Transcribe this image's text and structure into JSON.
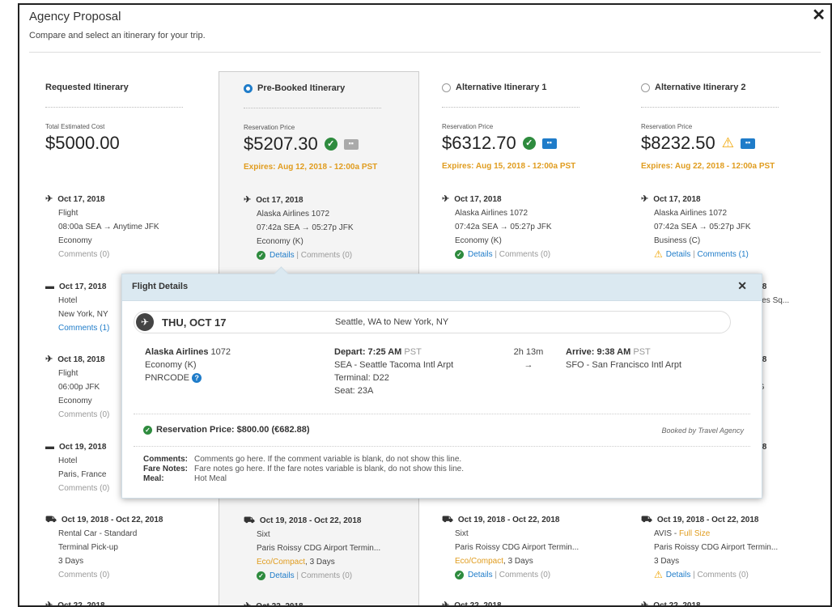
{
  "modal": {
    "title": "Agency Proposal",
    "subtitle": "Compare and select an itinerary for your trip.",
    "close_icon": "close-icon"
  },
  "columns": [
    {
      "header": "Requested Itinerary",
      "has_radio": false,
      "selected": false,
      "price_label": "Total Estimated Cost",
      "price": "$5000.00",
      "flight1": {
        "date": "Oct 17, 2018",
        "l1": "Flight",
        "l2": "08:00a SEA → Anytime JFK",
        "l3": "Economy",
        "links": "Comments (0)"
      },
      "hotel1": {
        "date": "Oct 17, 2018",
        "l1": "Hotel",
        "l2": "New York, NY",
        "links": "Comments (1)"
      },
      "flight2": {
        "date": "Oct 18, 2018",
        "l1": "Flight",
        "l2": "06:00p JFK",
        "l3": "Economy",
        "links": "Comments (0)"
      },
      "hotel2": {
        "date": "Oct 19, 2018",
        "l1": "Hotel",
        "l2": "Paris, France",
        "links": "Comments (0)"
      },
      "car": {
        "date": "Oct 19, 2018 - Oct 22, 2018",
        "l1": "Rental Car - Standard",
        "l2": "Terminal Pick-up",
        "l3": "3 Days",
        "links": "Comments (0)"
      },
      "next_date": "Oct 22, 2018"
    },
    {
      "header": "Pre-Booked Itinerary",
      "has_radio": true,
      "selected": true,
      "price_label": "Reservation Price",
      "price": "$5207.30",
      "expires": "Expires: Aug 12, 2018 - 12:00a PST",
      "flight1": {
        "date": "Oct 17, 2018",
        "l1": "Alaska Airlines 1072",
        "l2": "07:42a SEA → 05:27p JFK",
        "l3": "Economy (K)",
        "details": "Details",
        "comments": "Comments (0)"
      },
      "car": {
        "date": "Oct 19, 2018 - Oct 22, 2018",
        "l1": "Sixt",
        "l2": "Paris Roissy CDG Airport Termin...",
        "l3_a": "Eco/Compact",
        "l3_b": ", 3 Days",
        "details": "Details",
        "comments": "Comments (0)"
      },
      "next_date": "Oct 22, 2018"
    },
    {
      "header": "Alternative Itinerary 1",
      "has_radio": true,
      "selected": false,
      "price_label": "Reservation Price",
      "price": "$6312.70",
      "expires": "Expires: Aug 15, 2018 - 12:00a PST",
      "flight1": {
        "date": "Oct 17, 2018",
        "l1": "Alaska Airlines 1072",
        "l2": "07:42a SEA → 05:27p JFK",
        "l3": "Economy (K)",
        "details": "Details",
        "comments": "Comments (0)"
      },
      "car": {
        "date": "Oct 19, 2018 - Oct 22, 2018",
        "l1": "Sixt",
        "l2": "Paris Roissy CDG Airport Termin...",
        "l3_a": "Eco/Compact",
        "l3_b": ", 3 Days",
        "details": "Details",
        "comments": "Comments (0)"
      },
      "next_date": "Oct 22, 2018"
    },
    {
      "header": "Alternative Itinerary 2",
      "has_radio": true,
      "selected": false,
      "price_label": "Reservation Price",
      "price": "$8232.50",
      "expires": "Expires: Aug 22, 2018 - 12:00a PST",
      "flight1": {
        "date": "Oct 17, 2018",
        "l1": "Alaska Airlines 1072",
        "l2": "07:42a SEA → 05:27p JFK",
        "l3": "Business (C)",
        "details": "Details",
        "comments": "Comments (1)"
      },
      "hotel1": {
        "date": "8, 2018",
        "l1": "at Times Sq...",
        "l2": "ght",
        "links": "ts (1)"
      },
      "flight2": {
        "date": "9, 2018",
        "l1": "p CDG",
        "links": "ts (0)"
      },
      "hotel2": {
        "date": "2, 2018",
        "l1": "les",
        "l2": "ghts",
        "links": "ts (0)"
      },
      "car": {
        "date": "Oct 19, 2018 - Oct 22, 2018",
        "l1_a": "AVIS - ",
        "l1_b": "Full Size",
        "l2": "Paris Roissy CDG Airport Termin...",
        "l3": "3 Days",
        "details": "Details",
        "comments": "Comments (0)"
      },
      "next_date": "Oct 22, 2018"
    }
  ],
  "popup": {
    "title": "Flight Details",
    "day": "THU, OCT 17",
    "route": "Seattle, WA to New York, NY",
    "airline": "Alaska Airlines",
    "flight_no": "1072",
    "cabin": "Economy (K)",
    "pnr": "PNRCODE",
    "depart_label": "Depart: 7:25 AM",
    "depart_tz": "PST",
    "depart_airport": "SEA - Seattle Tacoma Intl Arpt",
    "terminal": "Terminal: D22",
    "seat": "Seat: 23A",
    "duration": "2h 13m",
    "arrow": "→",
    "arrive_label": "Arrive: 9:38 AM",
    "arrive_tz": "PST",
    "arrive_airport": "SFO - San Francisco Intl Arpt",
    "reservation": "Reservation Price: $800.00 (€682.88)",
    "booked_by": "Booked by Travel Agency",
    "comments_label": "Comments:",
    "comments": "Comments go here. If the comment variable is blank, do not show this line.",
    "fare_label": "Fare Notes:",
    "fare": "Fare notes go here. If the fare notes variable is blank, do not show this line.",
    "meal_label": "Meal:",
    "meal": "Hot Meal"
  },
  "colors": {
    "accent": "#1f7cc9",
    "ok": "#2e8b3e",
    "warn": "#f0a400",
    "expires": "#e09c1e"
  }
}
